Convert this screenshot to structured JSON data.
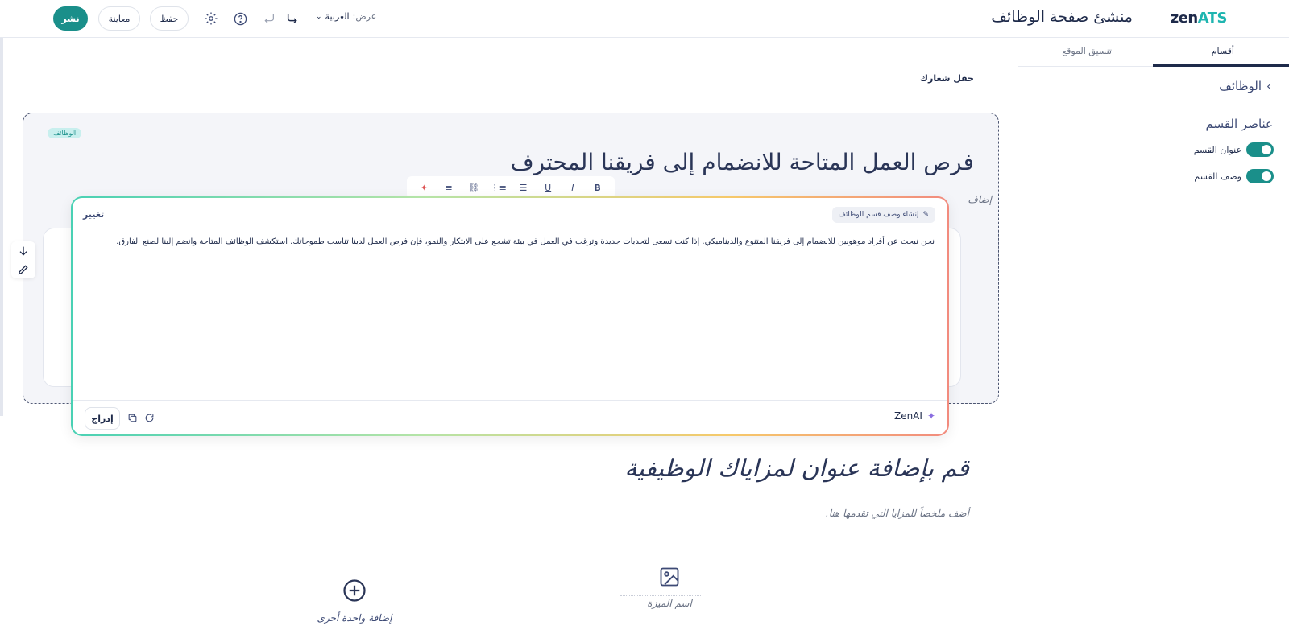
{
  "header": {
    "logo_main": "zen",
    "logo_accent": "ATS",
    "app_title": "منشئ صفحة الوظائف",
    "publish_label": "نشر",
    "preview_label": "معاينة",
    "save_label": "حفظ",
    "view_label": "عرض:",
    "language_value": "العربية",
    "icons": [
      "settings-icon",
      "help-icon",
      "undo-icon",
      "redo-icon",
      "chevron-down-icon"
    ]
  },
  "sidebar": {
    "tabs": [
      {
        "label": "أقسام",
        "active": true
      },
      {
        "label": "تنسيق الموقع",
        "active": false
      }
    ],
    "breadcrumb": "الوظائف",
    "heading": "عناصر القسم",
    "toggles": [
      {
        "label": "عنوان القسم",
        "on": true
      },
      {
        "label": "وصف القسم",
        "on": true
      }
    ]
  },
  "canvas": {
    "slogan_field": "حقل شعارك",
    "section_tag": "الوظائف",
    "section_title": "فرص العمل المتاحة للانضمام إلى فريقنا المحترف",
    "section_subtitle_partial": "إضاف",
    "benefits_title": "قم بإضافة عنوان لمزاياك الوظيفية",
    "benefits_subtitle": "أضف ملخصاً للمزايا التي تقدمها هنا.",
    "benefit_item_label": "اسم الميزة",
    "add_another_label": "إضافة واحدة أخرى"
  },
  "ai_modal": {
    "change_label": "تغيير",
    "generate_chip": "إنشاء وصف قسم الوظائف",
    "generated_text": "نحن نبحث عن أفراد موهوبين للانضمام إلى فريقنا المتنوع والديناميكي. إذا كنت تسعى لتحديات جديدة وترغب في العمل في بيئة تشجع على الابتكار والنمو، فإن فرص العمل لدينا تناسب طموحاتك. استكشف الوظائف المتاحة وانضم إلينا لصنع الفارق.",
    "insert_label": "إدراج",
    "brand": "ZenAI"
  },
  "toolbar": {
    "bold": "B",
    "italic": "I",
    "underline": "U"
  },
  "colors": {
    "accent": "#1a8f8a",
    "text": "#1e2a4a",
    "tag_bg": "#c8efee"
  }
}
